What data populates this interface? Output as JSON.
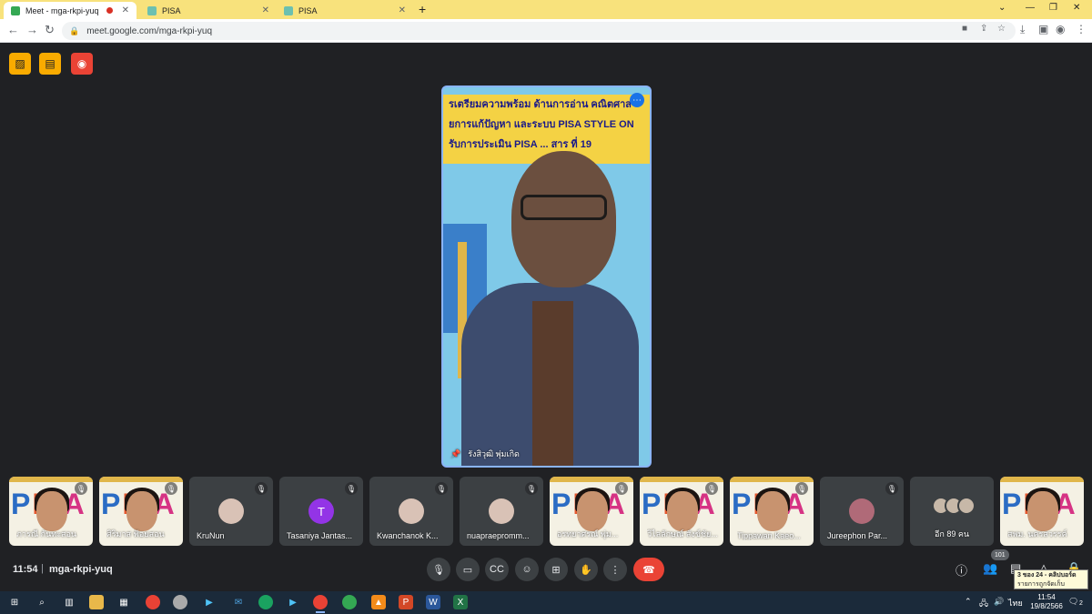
{
  "browser": {
    "tabs": [
      {
        "label": "Meet - mga-rkpi-yuq",
        "recording": true,
        "active": true
      },
      {
        "label": "PISA",
        "active": false
      },
      {
        "label": "PISA",
        "active": false
      }
    ],
    "new_tab": "+",
    "url": "meet.google.com/mga-rkpi-yuq"
  },
  "meet": {
    "speaker": {
      "name": "รังสิวุฒิ พุ่มเกิด",
      "banner_lines": [
        "รเตรียมความพร้อม ด้านการอ่าน คณิตศาส",
        "ยการแก้ปัญหา และระบบ PISA STYLE ON",
        "รับการประเมิน PISA ... สาร ที่ 19"
      ]
    },
    "participants": [
      {
        "name": "ภารณี กันทะสอน",
        "kind": "pisa"
      },
      {
        "name": "ศิริมาส ฟ้อยสอน",
        "kind": "pisa"
      },
      {
        "name": "KruNun",
        "kind": "photo"
      },
      {
        "name": "Tasaniya Jantas...",
        "kind": "letter",
        "initial": "T"
      },
      {
        "name": "Kwanchanok K...",
        "kind": "photo"
      },
      {
        "name": "nuapraepromm...",
        "kind": "photo"
      },
      {
        "name": "อรทยาศรณ์ พุ่ม...",
        "kind": "pisa"
      },
      {
        "name": "วิไลลักษณ์ สังข์ชัย...",
        "kind": "pisa"
      },
      {
        "name": "Tippawan Kaeo...",
        "kind": "pisa"
      },
      {
        "name": "Jureephon Par...",
        "kind": "photo"
      },
      {
        "name": "อีก 89 คน",
        "kind": "more"
      },
      {
        "name": "สพม. นครสวรรค์",
        "kind": "pisa"
      }
    ],
    "footer": {
      "time": "11:54",
      "separator": "|",
      "meeting_code": "mga-rkpi-yuq",
      "people_count": "101"
    },
    "tooltip": {
      "line1": "3 ของ 24 - คลิปบอร์ด",
      "line2": "รายการถูกจัดเก็บ"
    }
  },
  "taskbar": {
    "language": "ไทย",
    "clock_time": "11:54",
    "clock_date": "19/8/2566",
    "notifications": "2"
  }
}
